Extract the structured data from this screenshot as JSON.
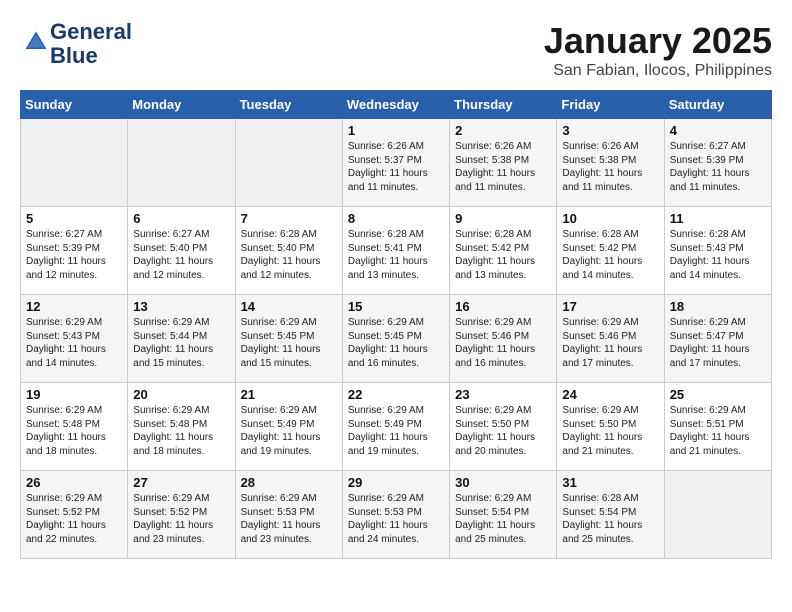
{
  "header": {
    "logo_line1": "General",
    "logo_line2": "Blue",
    "month": "January 2025",
    "location": "San Fabian, Ilocos, Philippines"
  },
  "days_of_week": [
    "Sunday",
    "Monday",
    "Tuesday",
    "Wednesday",
    "Thursday",
    "Friday",
    "Saturday"
  ],
  "weeks": [
    [
      {
        "day": "",
        "info": ""
      },
      {
        "day": "",
        "info": ""
      },
      {
        "day": "",
        "info": ""
      },
      {
        "day": "1",
        "info": "Sunrise: 6:26 AM\nSunset: 5:37 PM\nDaylight: 11 hours\nand 11 minutes."
      },
      {
        "day": "2",
        "info": "Sunrise: 6:26 AM\nSunset: 5:38 PM\nDaylight: 11 hours\nand 11 minutes."
      },
      {
        "day": "3",
        "info": "Sunrise: 6:26 AM\nSunset: 5:38 PM\nDaylight: 11 hours\nand 11 minutes."
      },
      {
        "day": "4",
        "info": "Sunrise: 6:27 AM\nSunset: 5:39 PM\nDaylight: 11 hours\nand 11 minutes."
      }
    ],
    [
      {
        "day": "5",
        "info": "Sunrise: 6:27 AM\nSunset: 5:39 PM\nDaylight: 11 hours\nand 12 minutes."
      },
      {
        "day": "6",
        "info": "Sunrise: 6:27 AM\nSunset: 5:40 PM\nDaylight: 11 hours\nand 12 minutes."
      },
      {
        "day": "7",
        "info": "Sunrise: 6:28 AM\nSunset: 5:40 PM\nDaylight: 11 hours\nand 12 minutes."
      },
      {
        "day": "8",
        "info": "Sunrise: 6:28 AM\nSunset: 5:41 PM\nDaylight: 11 hours\nand 13 minutes."
      },
      {
        "day": "9",
        "info": "Sunrise: 6:28 AM\nSunset: 5:42 PM\nDaylight: 11 hours\nand 13 minutes."
      },
      {
        "day": "10",
        "info": "Sunrise: 6:28 AM\nSunset: 5:42 PM\nDaylight: 11 hours\nand 14 minutes."
      },
      {
        "day": "11",
        "info": "Sunrise: 6:28 AM\nSunset: 5:43 PM\nDaylight: 11 hours\nand 14 minutes."
      }
    ],
    [
      {
        "day": "12",
        "info": "Sunrise: 6:29 AM\nSunset: 5:43 PM\nDaylight: 11 hours\nand 14 minutes."
      },
      {
        "day": "13",
        "info": "Sunrise: 6:29 AM\nSunset: 5:44 PM\nDaylight: 11 hours\nand 15 minutes."
      },
      {
        "day": "14",
        "info": "Sunrise: 6:29 AM\nSunset: 5:45 PM\nDaylight: 11 hours\nand 15 minutes."
      },
      {
        "day": "15",
        "info": "Sunrise: 6:29 AM\nSunset: 5:45 PM\nDaylight: 11 hours\nand 16 minutes."
      },
      {
        "day": "16",
        "info": "Sunrise: 6:29 AM\nSunset: 5:46 PM\nDaylight: 11 hours\nand 16 minutes."
      },
      {
        "day": "17",
        "info": "Sunrise: 6:29 AM\nSunset: 5:46 PM\nDaylight: 11 hours\nand 17 minutes."
      },
      {
        "day": "18",
        "info": "Sunrise: 6:29 AM\nSunset: 5:47 PM\nDaylight: 11 hours\nand 17 minutes."
      }
    ],
    [
      {
        "day": "19",
        "info": "Sunrise: 6:29 AM\nSunset: 5:48 PM\nDaylight: 11 hours\nand 18 minutes."
      },
      {
        "day": "20",
        "info": "Sunrise: 6:29 AM\nSunset: 5:48 PM\nDaylight: 11 hours\nand 18 minutes."
      },
      {
        "day": "21",
        "info": "Sunrise: 6:29 AM\nSunset: 5:49 PM\nDaylight: 11 hours\nand 19 minutes."
      },
      {
        "day": "22",
        "info": "Sunrise: 6:29 AM\nSunset: 5:49 PM\nDaylight: 11 hours\nand 19 minutes."
      },
      {
        "day": "23",
        "info": "Sunrise: 6:29 AM\nSunset: 5:50 PM\nDaylight: 11 hours\nand 20 minutes."
      },
      {
        "day": "24",
        "info": "Sunrise: 6:29 AM\nSunset: 5:50 PM\nDaylight: 11 hours\nand 21 minutes."
      },
      {
        "day": "25",
        "info": "Sunrise: 6:29 AM\nSunset: 5:51 PM\nDaylight: 11 hours\nand 21 minutes."
      }
    ],
    [
      {
        "day": "26",
        "info": "Sunrise: 6:29 AM\nSunset: 5:52 PM\nDaylight: 11 hours\nand 22 minutes."
      },
      {
        "day": "27",
        "info": "Sunrise: 6:29 AM\nSunset: 5:52 PM\nDaylight: 11 hours\nand 23 minutes."
      },
      {
        "day": "28",
        "info": "Sunrise: 6:29 AM\nSunset: 5:53 PM\nDaylight: 11 hours\nand 23 minutes."
      },
      {
        "day": "29",
        "info": "Sunrise: 6:29 AM\nSunset: 5:53 PM\nDaylight: 11 hours\nand 24 minutes."
      },
      {
        "day": "30",
        "info": "Sunrise: 6:29 AM\nSunset: 5:54 PM\nDaylight: 11 hours\nand 25 minutes."
      },
      {
        "day": "31",
        "info": "Sunrise: 6:28 AM\nSunset: 5:54 PM\nDaylight: 11 hours\nand 25 minutes."
      },
      {
        "day": "",
        "info": ""
      }
    ]
  ]
}
